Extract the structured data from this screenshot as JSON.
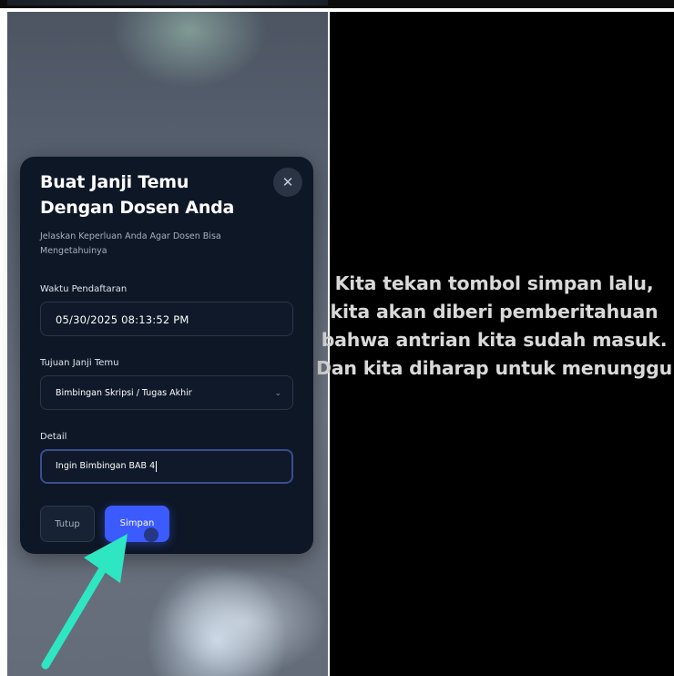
{
  "caption": {
    "text": "Kita tekan tombol simpan lalu, kita akan diberi pemberitahuan bahwa antrian kita sudah masuk. Dan kita diharap untuk menunggu"
  },
  "modal": {
    "title": "Buat Janji Temu Dengan Dosen Anda",
    "subtitle": "Jelaskan Keperluan Anda Agar Dosen Bisa Mengetahuinya",
    "close_icon": "x-icon",
    "fields": {
      "registration_time": {
        "label": "Waktu Pendaftaran",
        "value": "05/30/2025 08:13:52 PM"
      },
      "purpose": {
        "label": "Tujuan Janji Temu",
        "value": "Bimbingan Skripsi / Tugas Akhir",
        "icon": "chevron-down-icon"
      },
      "detail": {
        "label": "Detail",
        "value": "Ingin Bimbingan BAB 4"
      }
    },
    "buttons": {
      "close_label": "Tutup",
      "save_label": "Simpan"
    }
  },
  "colors": {
    "modal_bg": "#0e1726",
    "primary_button": "#3b5bff",
    "arrow": "#2ee6c2",
    "caption_text": "#d9d9d9"
  }
}
